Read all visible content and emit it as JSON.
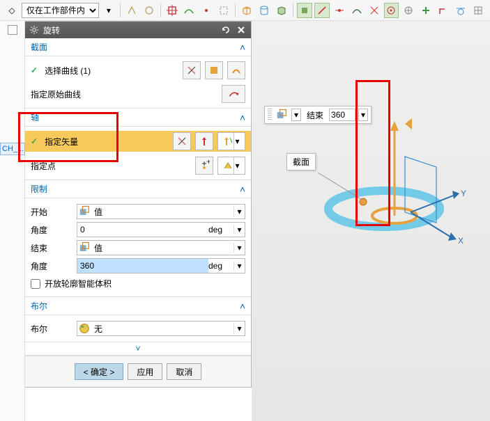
{
  "toolbar": {
    "filter_marker": "◇",
    "filter_label": "仅在工作部件内"
  },
  "left": {
    "active_tab": "CH_..."
  },
  "panel": {
    "title": "旋转",
    "sections": {
      "section1": {
        "title": "截面",
        "select_curve_label": "选择曲线 (1)",
        "origin_curve_label": "指定原始曲线"
      },
      "axis": {
        "title": "轴",
        "specify_vector_label": "指定矢量",
        "specify_point_label": "指定点"
      },
      "limit": {
        "title": "限制",
        "start_label": "开始",
        "start_mode": "值",
        "angle_label": "角度",
        "start_angle": "0",
        "end_label": "结束",
        "end_mode": "值",
        "end_angle": "360",
        "unit": "deg",
        "open_profile_label": "开放轮廓智能体积"
      },
      "bool": {
        "title": "布尔",
        "label": "布尔",
        "value": "无"
      }
    },
    "footer": {
      "ok": "< 确定 >",
      "apply": "应用",
      "cancel": "取消"
    }
  },
  "viewport": {
    "float_bar_label": "结束",
    "float_bar_value": "360",
    "section_label": "截面",
    "axes": {
      "x": "X",
      "y": "Y"
    }
  }
}
